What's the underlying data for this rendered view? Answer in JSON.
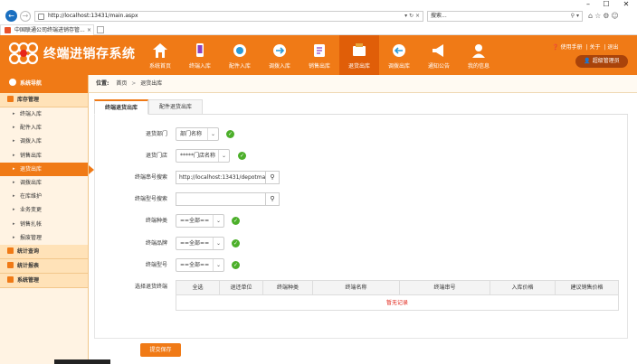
{
  "browser": {
    "url": "http://localhost:13431/main.aspx",
    "search_placeholder": "搜索...",
    "tab_title": "中国联通公司终端进销存管...",
    "window_min": "–",
    "window_max": "☐",
    "window_close": "✕"
  },
  "app": {
    "name": "终端进销存系统",
    "toplinks": [
      "使用手册",
      "关于",
      "退出"
    ],
    "user": "超级管理员",
    "nav": [
      {
        "label": "系统首页",
        "icon": "home-icon"
      },
      {
        "label": "终端入库",
        "icon": "phone-in-icon"
      },
      {
        "label": "配件入库",
        "icon": "headset-in-icon"
      },
      {
        "label": "调拨入库",
        "icon": "transfer-in-icon"
      },
      {
        "label": "销售出库",
        "icon": "sale-out-icon"
      },
      {
        "label": "退货出库",
        "icon": "return-out-icon"
      },
      {
        "label": "调拨出库",
        "icon": "transfer-out-icon"
      },
      {
        "label": "通知公告",
        "icon": "megaphone-icon"
      },
      {
        "label": "我的信息",
        "icon": "user-info-icon"
      }
    ],
    "active_nav": 5
  },
  "sidebar": {
    "title": "系统导航",
    "groups": [
      {
        "label": "库存管理",
        "items": [
          "终端入库",
          "配件入库",
          "调拨入库",
          "销售出库",
          "退货出库",
          "调拨出库",
          "在库维护",
          "业务变更",
          "销售扎帐",
          "报废管理"
        ]
      },
      {
        "label": "统计查询",
        "items": []
      },
      {
        "label": "统计报表",
        "items": []
      },
      {
        "label": "系统管理",
        "items": []
      }
    ],
    "active_item": 4
  },
  "breadcrumb": {
    "prefix": "位置:",
    "home": "首页",
    "sep": ">",
    "current": "退货出库"
  },
  "tabs": [
    "终端退货出库",
    "配件退货出库"
  ],
  "form": {
    "dept_label": "退货部门",
    "dept_value": "部门名称",
    "store_label": "退货门店",
    "store_value": "*****门店名称",
    "serial_label": "终端串号搜索",
    "serial_value": "http://localhost:13431/depotmanage",
    "model_search_label": "终端型号搜索",
    "model_search_value": "",
    "type_label": "终端种类",
    "type_value": "==全部==",
    "brand_label": "终端品牌",
    "brand_value": "==全部==",
    "model_label": "终端型号",
    "model_value": "==全部==",
    "select_label": "选择退货终端",
    "submit": "提交保存"
  },
  "table": {
    "columns": [
      "全选",
      "退还单位",
      "终端种类",
      "终端名称",
      "终端串号",
      "入库价格",
      "建议销售价格"
    ],
    "empty_text": "暂无记录"
  },
  "colors": {
    "brand": "#f07a16",
    "ok": "#4caf2a",
    "empty_text": "#e2261a"
  }
}
